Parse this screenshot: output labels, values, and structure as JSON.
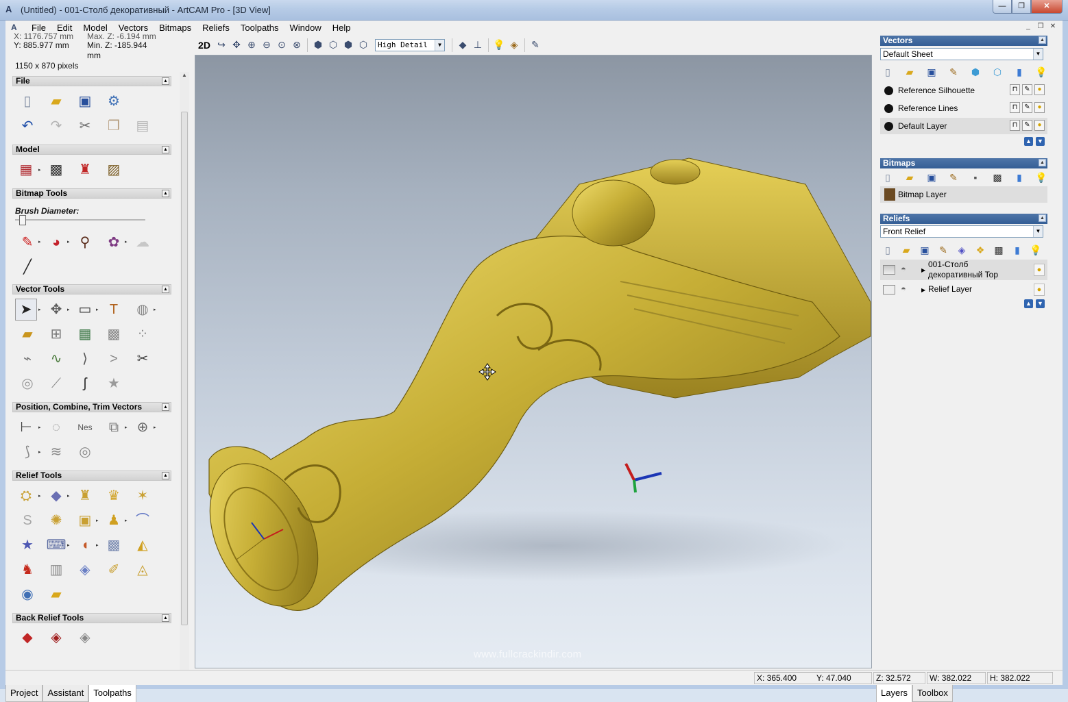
{
  "window": {
    "title": "(Untitled) - 001-Столб декоративный - ArtCAM Pro - [3D View]",
    "minimize": "—",
    "maximize": "❐",
    "close": "✕"
  },
  "menu": {
    "items": [
      "File",
      "Edit",
      "Model",
      "Vectors",
      "Bitmaps",
      "Reliefs",
      "Toolpaths",
      "Window",
      "Help"
    ],
    "mdi": [
      "_",
      "❐",
      "✕"
    ]
  },
  "info": {
    "line1": "X: 1176.757 mm",
    "line2": "Y: 885.977 mm",
    "max_z": "Max. Z: -6.194 mm",
    "min_z": "Min. Z: -185.944",
    "min_z_unit": "mm",
    "pixels": "1150 x 870 pixels"
  },
  "sections": {
    "file": "File",
    "model": "Model",
    "bitmap_tools": "Bitmap Tools",
    "brush_diameter": "Brush Diameter:",
    "vector_tools": "Vector Tools",
    "position": "Position, Combine, Trim Vectors",
    "relief_tools": "Relief Tools",
    "back_relief": "Back Relief Tools"
  },
  "left_tabs": [
    "Project",
    "Assistant",
    "Toolpaths"
  ],
  "view_toolbar": {
    "mode": "2D",
    "detail": "High Detail"
  },
  "watermark": "www.fullcrackindir.com",
  "vectors_panel": {
    "title": "Vectors",
    "sheet": "Default Sheet",
    "layers": [
      {
        "name": "Reference Silhouette"
      },
      {
        "name": "Reference Lines"
      },
      {
        "name": "Default Layer"
      }
    ]
  },
  "bitmaps_panel": {
    "title": "Bitmaps",
    "layer": "Bitmap Layer"
  },
  "reliefs_panel": {
    "title": "Reliefs",
    "selected": "Front Relief",
    "items": [
      "001-Столб",
      "декоративный Top",
      "Relief Layer"
    ]
  },
  "right_tabs": [
    "Layers",
    "Toolbox"
  ],
  "status": {
    "x": "X: 365.400",
    "y": "Y: 47.040",
    "z": "Z: 32.572",
    "w": "W: 382.022",
    "h": "H: 382.022"
  },
  "colors": {
    "relief": "#c9b43a",
    "view_top": "#8c96a3",
    "view_bottom": "#e6ecf3",
    "panel_header": "#345e95"
  }
}
